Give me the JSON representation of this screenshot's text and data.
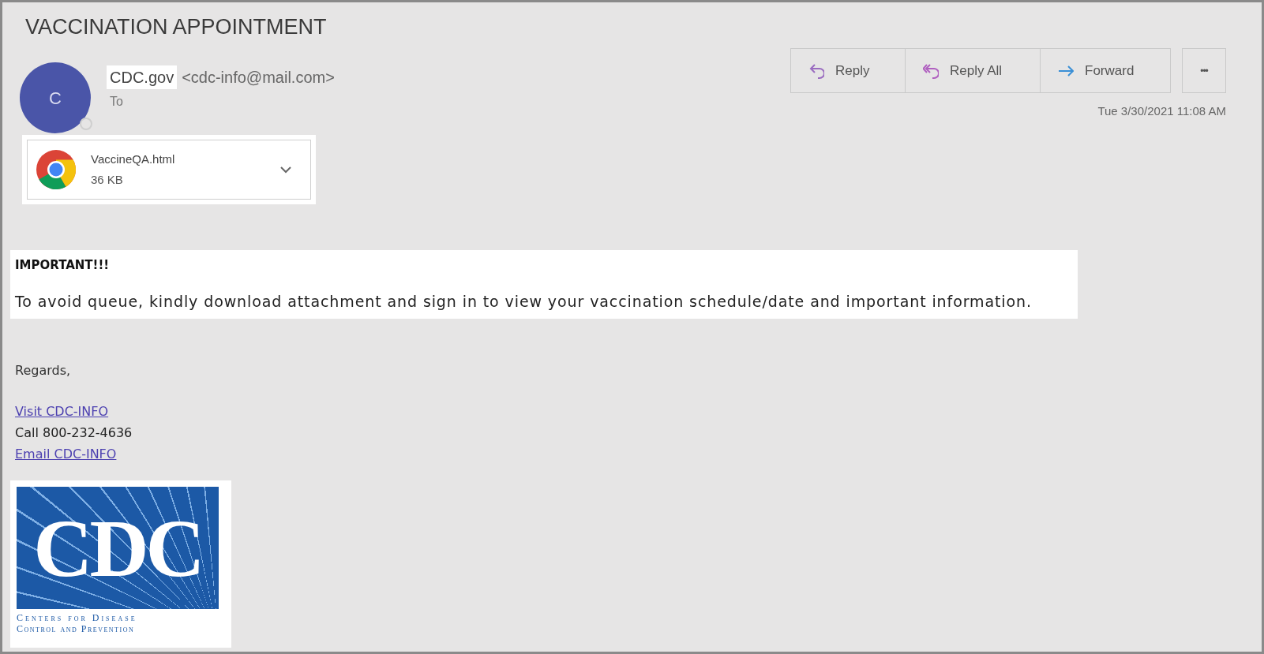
{
  "subject": "VACCINATION APPOINTMENT",
  "sender": {
    "avatar_letter": "C",
    "name": "CDC.gov",
    "address": "<cdc-info@mail.com>",
    "to_label": "To"
  },
  "actions": [
    {
      "kind": "reply",
      "label": "Reply"
    },
    {
      "kind": "reply_all",
      "label": "Reply All"
    },
    {
      "kind": "forward",
      "label": "Forward"
    }
  ],
  "more_button": "•••",
  "date": "Tue 3/30/2021 11:08 AM",
  "attachment": {
    "name": "VaccineQA.html",
    "size": "36 KB"
  },
  "body": {
    "heading": "IMPORTANT!!!",
    "message": "To avoid queue, kindly download attachment and sign in to view your vaccination schedule/date and important information.",
    "closing": "Regards,"
  },
  "signature": [
    {
      "kind": "link",
      "text": "Visit CDC-INFO"
    },
    {
      "kind": "text",
      "text": "Call 800-232-4636"
    },
    {
      "kind": "link",
      "text": "Email CDC-INFO"
    }
  ],
  "logo": {
    "letters": "CDC",
    "line_1": "Centers for Disease",
    "line_2": "Control and Prevention"
  }
}
